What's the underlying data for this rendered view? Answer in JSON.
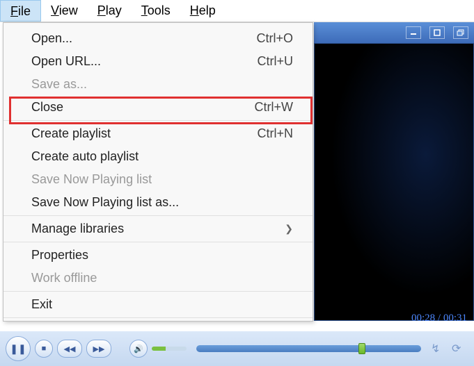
{
  "menubar": {
    "items": [
      {
        "label": "File",
        "accel": "F",
        "active": true
      },
      {
        "label": "View",
        "accel": "V"
      },
      {
        "label": "Play",
        "accel": "P"
      },
      {
        "label": "Tools",
        "accel": "T"
      },
      {
        "label": "Help",
        "accel": "H"
      }
    ]
  },
  "dropdown": {
    "groups": [
      [
        {
          "label": "Open...",
          "shortcut": "Ctrl+O",
          "disabled": false
        },
        {
          "label": "Open URL...",
          "shortcut": "Ctrl+U",
          "disabled": false
        },
        {
          "label": "Save as...",
          "shortcut": "",
          "disabled": true,
          "highlighted": true
        },
        {
          "label": "Close",
          "shortcut": "Ctrl+W",
          "disabled": false
        }
      ],
      [
        {
          "label": "Create playlist",
          "shortcut": "Ctrl+N",
          "disabled": false
        },
        {
          "label": "Create auto playlist",
          "shortcut": "",
          "disabled": false
        },
        {
          "label": "Save Now Playing list",
          "shortcut": "",
          "disabled": true
        },
        {
          "label": "Save Now Playing list as...",
          "shortcut": "",
          "disabled": false
        }
      ],
      [
        {
          "label": "Manage libraries",
          "shortcut": "",
          "disabled": false,
          "submenu": true
        }
      ],
      [
        {
          "label": "Properties",
          "shortcut": "",
          "disabled": false
        },
        {
          "label": "Work offline",
          "shortcut": "",
          "disabled": true
        }
      ],
      [
        {
          "label": "Exit",
          "shortcut": "",
          "disabled": false
        }
      ]
    ]
  },
  "playback": {
    "time_current": "00:28",
    "time_total": "00:31",
    "time_display": "00:28 / 00:31"
  },
  "titlebar_buttons": [
    "minimize",
    "maximize",
    "restore"
  ],
  "controls": {
    "play": "▶",
    "stop": "■",
    "prev": "|◀◀",
    "next": "▶▶|",
    "mute": "🔊"
  }
}
